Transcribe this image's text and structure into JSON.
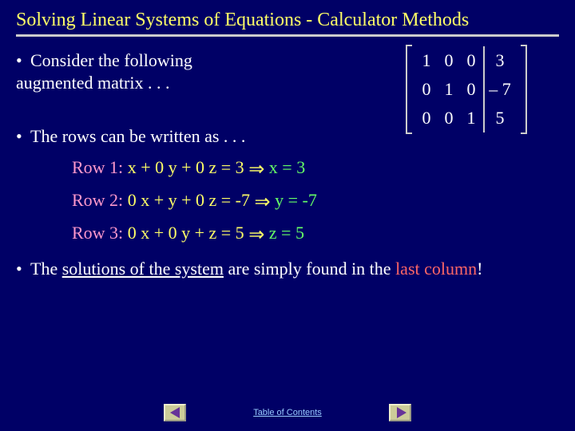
{
  "title": "Solving Linear Systems of Equations - Calculator Methods",
  "bullets": {
    "b1": "Consider the following augmented matrix . . .",
    "b2": "The rows can be written as . . .",
    "b3a": "The ",
    "b3b": "solutions of the system",
    "b3c": " are simply found in the ",
    "b3d": "last column",
    "b3e": "!"
  },
  "matrix": {
    "r1c1": "1",
    "r1c2": "0",
    "r1c3": "0",
    "r1a": "3",
    "r2c1": "0",
    "r2c2": "1",
    "r2c3": "0",
    "r2a": "– 7",
    "r3c1": "0",
    "r3c2": "0",
    "r3c3": "1",
    "r3a": "5"
  },
  "rows": {
    "r1": {
      "label": "Row 1: ",
      "eq": " x + 0 y + 0 z = 3 ",
      "sol": " x = 3"
    },
    "r2": {
      "label": "Row 2: ",
      "eq": " 0 x + y + 0 z = -7 ",
      "sol": " y = -7"
    },
    "r3": {
      "label": "Row 3: ",
      "eq": " 0 x + 0 y + z = 5 ",
      "sol": " z = 5"
    }
  },
  "implies_glyph": "⇒",
  "footer": {
    "toc": "Table of Contents"
  }
}
